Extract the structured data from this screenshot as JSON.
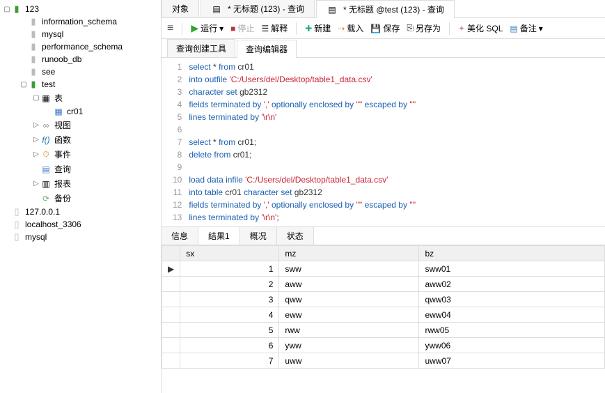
{
  "sidebar": {
    "root": "123",
    "items": [
      {
        "label": "information_schema",
        "icon": "db-gray",
        "indent": 24
      },
      {
        "label": "mysql",
        "icon": "db-gray",
        "indent": 24
      },
      {
        "label": "performance_schema",
        "icon": "db-gray",
        "indent": 24
      },
      {
        "label": "runoob_db",
        "icon": "db-gray",
        "indent": 24
      },
      {
        "label": "see",
        "icon": "db-gray",
        "indent": 24
      },
      {
        "label": "test",
        "icon": "db-green",
        "indent": 24,
        "arrow": "▢"
      },
      {
        "label": "表",
        "icon": "table",
        "indent": 42,
        "arrow": "▢"
      },
      {
        "label": "cr01",
        "icon": "grid",
        "indent": 60
      },
      {
        "label": "视图",
        "icon": "view",
        "indent": 42,
        "arrow": "▷"
      },
      {
        "label": "函数",
        "icon": "fx",
        "indent": 42,
        "arrow": "▷"
      },
      {
        "label": "事件",
        "icon": "event",
        "indent": 42,
        "arrow": "▷"
      },
      {
        "label": "查询",
        "icon": "query",
        "indent": 42
      },
      {
        "label": "报表",
        "icon": "report",
        "indent": 42,
        "arrow": "▷"
      },
      {
        "label": "备份",
        "icon": "backup",
        "indent": 42
      }
    ],
    "conns": [
      {
        "label": "127.0.0.1"
      },
      {
        "label": "localhost_3306"
      },
      {
        "label": "mysql"
      }
    ]
  },
  "tabs": {
    "t0": "对象",
    "t1": "* 无标题 (123) - 查询",
    "t2": "* 无标题 @test (123) - 查询"
  },
  "toolbar": {
    "run": "运行",
    "stop": "停止",
    "explain": "解释",
    "new": "新建",
    "load": "载入",
    "save": "保存",
    "saveas": "另存为",
    "beautify": "美化 SQL",
    "note": "备注"
  },
  "subtabs": {
    "a": "查询创建工具",
    "b": "查询编辑器"
  },
  "code_lines": [
    {
      "n": 1,
      "tokens": [
        [
          "kw",
          "select"
        ],
        [
          "id",
          " * "
        ],
        [
          "kw",
          "from"
        ],
        [
          "id",
          " cr01"
        ]
      ]
    },
    {
      "n": 2,
      "tokens": [
        [
          "kw",
          "into outfile "
        ],
        [
          "str",
          "'C:/Users/del/Desktop/table1_data.csv'"
        ]
      ]
    },
    {
      "n": 3,
      "tokens": [
        [
          "kw",
          "character set"
        ],
        [
          "id",
          " gb2312"
        ]
      ]
    },
    {
      "n": 4,
      "tokens": [
        [
          "kw",
          "fields terminated by "
        ],
        [
          "str",
          "','"
        ],
        [
          "kw",
          " optionally enclosed by "
        ],
        [
          "str",
          "'\"'"
        ],
        [
          "kw",
          " escaped by "
        ],
        [
          "str",
          "'\"'"
        ]
      ]
    },
    {
      "n": 5,
      "tokens": [
        [
          "kw",
          "lines terminated by "
        ],
        [
          "str",
          "'\\r\\n'"
        ]
      ]
    },
    {
      "n": 6,
      "tokens": []
    },
    {
      "n": 7,
      "tokens": [
        [
          "kw",
          "select"
        ],
        [
          "id",
          " * "
        ],
        [
          "kw",
          "from"
        ],
        [
          "id",
          " cr01;"
        ]
      ]
    },
    {
      "n": 8,
      "tokens": [
        [
          "kw",
          "delete  from"
        ],
        [
          "id",
          " cr01;"
        ]
      ]
    },
    {
      "n": 9,
      "tokens": []
    },
    {
      "n": 10,
      "tokens": [
        [
          "kw",
          "load data infile "
        ],
        [
          "str",
          "'C:/Users/del/Desktop/table1_data.csv'"
        ]
      ]
    },
    {
      "n": 11,
      "tokens": [
        [
          "kw",
          "into table"
        ],
        [
          "id",
          " cr01 "
        ],
        [
          "kw",
          "character set"
        ],
        [
          "id",
          " gb2312"
        ]
      ]
    },
    {
      "n": 12,
      "tokens": [
        [
          "kw",
          "fields terminated by "
        ],
        [
          "str",
          "','"
        ],
        [
          "kw",
          " optionally enclosed by "
        ],
        [
          "str",
          "'\"'"
        ],
        [
          "kw",
          " escaped by "
        ],
        [
          "str",
          "'\"'"
        ]
      ]
    },
    {
      "n": 13,
      "tokens": [
        [
          "kw",
          "lines terminated by "
        ],
        [
          "str",
          "'\\r\\n'"
        ],
        [
          "id",
          ";"
        ]
      ]
    }
  ],
  "result_tabs": {
    "a": "信息",
    "b": "结果1",
    "c": "概况",
    "d": "状态"
  },
  "result": {
    "cols": [
      "sx",
      "mz",
      "bz"
    ],
    "rows": [
      [
        1,
        "sww",
        "sww01"
      ],
      [
        2,
        "aww",
        "aww02"
      ],
      [
        3,
        "qww",
        "qww03"
      ],
      [
        4,
        "eww",
        "eww04"
      ],
      [
        5,
        "rww",
        "rww05"
      ],
      [
        6,
        "yww",
        "yww06"
      ],
      [
        7,
        "uww",
        "uww07"
      ]
    ]
  }
}
